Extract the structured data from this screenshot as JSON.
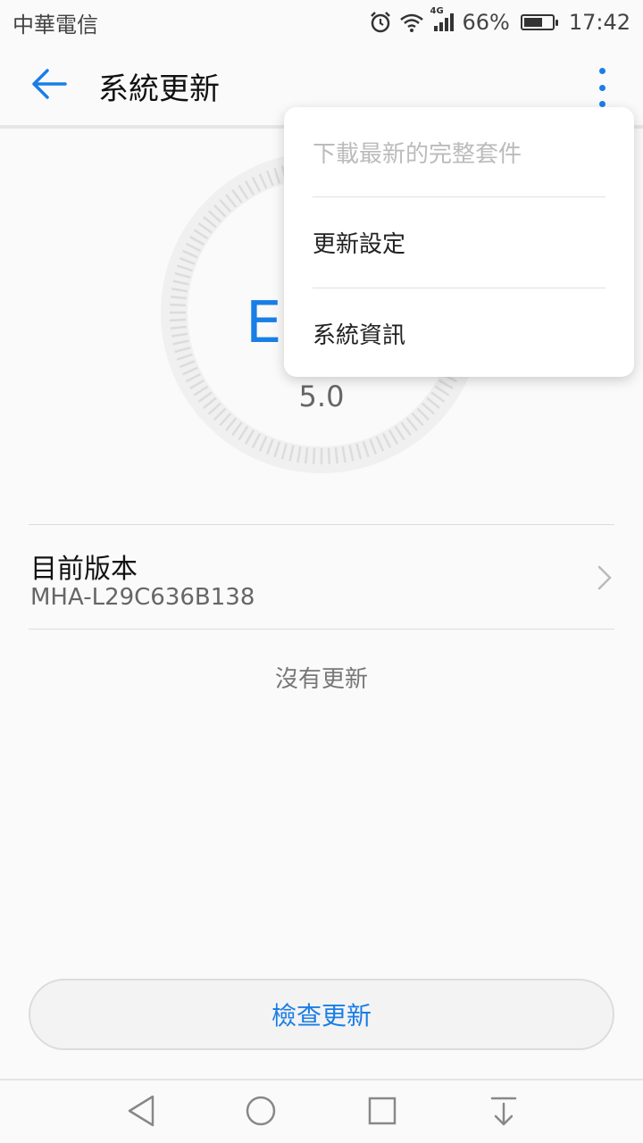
{
  "status_bar": {
    "carrier": "中華電信",
    "network": "4G",
    "battery": "66%",
    "time": "17:42",
    "icons": [
      "alarm-icon",
      "wifi-icon",
      "signal-icon",
      "battery-icon"
    ]
  },
  "app_bar": {
    "title": "系統更新",
    "back_icon": "arrow-left-icon",
    "more_icon": "more-vertical-icon",
    "accent_color": "#1a7ee6"
  },
  "dial": {
    "letter": "E",
    "version": "5.0"
  },
  "current_version": {
    "label": "目前版本",
    "value": "MHA-L29C636B138"
  },
  "status_message": "沒有更新",
  "check_button": {
    "label": "檢查更新"
  },
  "menu": {
    "items": [
      {
        "label": "下載最新的完整套件",
        "enabled": false
      },
      {
        "label": "更新設定",
        "enabled": true
      },
      {
        "label": "系統資訊",
        "enabled": true
      }
    ]
  },
  "nav_bar": {
    "icons": [
      "back-triangle-icon",
      "home-circle-icon",
      "recents-square-icon",
      "notification-pull-icon"
    ]
  }
}
